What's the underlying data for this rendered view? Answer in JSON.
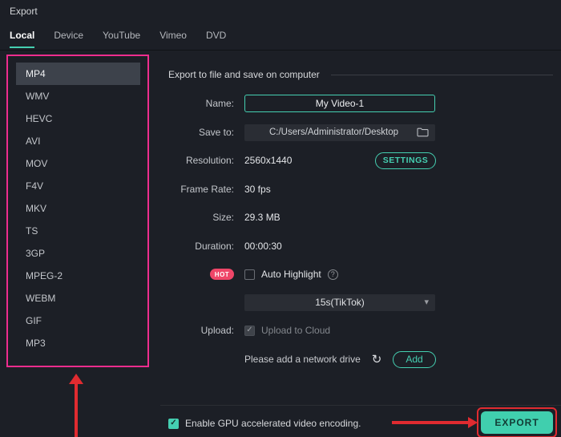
{
  "window": {
    "title": "Export"
  },
  "tabs": [
    {
      "label": "Local"
    },
    {
      "label": "Device"
    },
    {
      "label": "YouTube"
    },
    {
      "label": "Vimeo"
    },
    {
      "label": "DVD"
    }
  ],
  "sidebar": {
    "selected": "MP4",
    "formats": [
      "MP4",
      "WMV",
      "HEVC",
      "AVI",
      "MOV",
      "F4V",
      "MKV",
      "TS",
      "3GP",
      "MPEG-2",
      "WEBM",
      "GIF",
      "MP3"
    ]
  },
  "main": {
    "section_title": "Export to file and save on computer",
    "name": {
      "label": "Name:",
      "value": "My Video-1"
    },
    "save_to": {
      "label": "Save to:",
      "value": "C:/Users/Administrator/Desktop"
    },
    "resolution": {
      "label": "Resolution:",
      "value": "2560x1440",
      "settings_button": "SETTINGS"
    },
    "frame_rate": {
      "label": "Frame Rate:",
      "value": "30 fps"
    },
    "size": {
      "label": "Size:",
      "value": "29.3 MB"
    },
    "duration": {
      "label": "Duration:",
      "value": "00:00:30"
    },
    "auto_highlight": {
      "badge": "HOT",
      "label": "Auto Highlight"
    },
    "preset_dropdown": {
      "value": "15s(TikTok)"
    },
    "upload": {
      "label": "Upload:",
      "option": "Upload to Cloud"
    },
    "network": {
      "text": "Please add a network drive",
      "add_button": "Add"
    }
  },
  "footer": {
    "gpu_label": "Enable GPU accelerated video encoding.",
    "export_button": "EXPORT"
  },
  "icons": {
    "chevron_down": "▾",
    "refresh": "↻",
    "question": "?",
    "check": "✓"
  },
  "colors": {
    "accent": "#45cfb1",
    "annotation_pink": "#ee2d8e",
    "annotation_red": "#e02b30",
    "hot_badge": "#ef4668"
  }
}
